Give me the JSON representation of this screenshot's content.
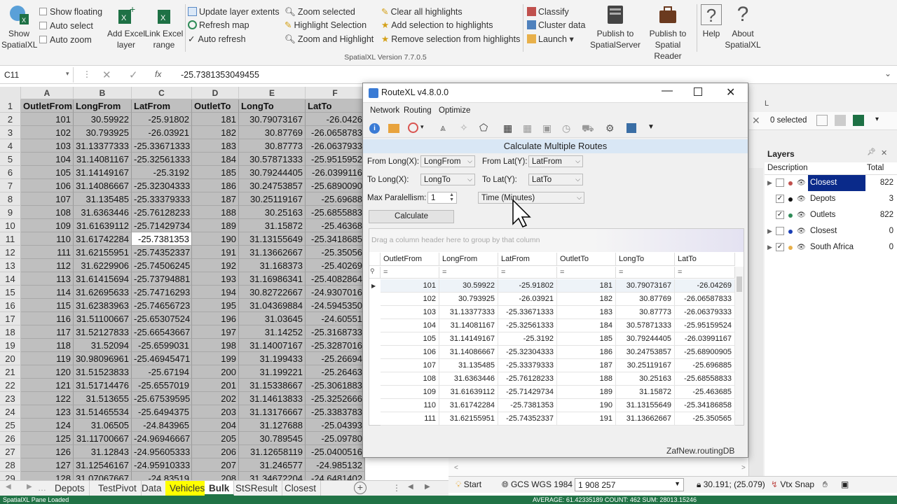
{
  "ribbon": {
    "show_spatialxl": "Show\nSpatialXL",
    "show_floating": "Show floating",
    "auto_select": "Auto select",
    "auto_zoom": "Auto zoom",
    "add_excel_layer": "Add Excel\nlayer",
    "link_excel_range": "Link Excel\nrange",
    "update_layer_extents": "Update layer extents",
    "refresh_map": "Refresh map",
    "auto_refresh": "Auto refresh",
    "zoom_selected": "Zoom selected",
    "highlight_selection": "Highlight Selection",
    "zoom_and_highlight": "Zoom and Highlight",
    "clear_all_highlights": "Clear all highlights",
    "add_selection_to_highlights": "Add selection to highlights",
    "remove_selection_from_highlights": "Remove selection from highlights",
    "classify": "Classify",
    "cluster_data": "Cluster data",
    "launch": "Launch",
    "publish_spatialserver": "Publish to\nSpatialServer",
    "publish_spatialreader": "Publish to\nSpatial Reader",
    "help": "Help",
    "about": "About\nSpatialXL",
    "version": "SpatialXL Version 7.7.0.5"
  },
  "formula": {
    "namebox": "C11",
    "value": "-25.7381353049455",
    "fx": "fx"
  },
  "sheet": {
    "columns": [
      "A",
      "B",
      "C",
      "D",
      "E",
      "F"
    ],
    "header": [
      "OutletFrom",
      "LongFrom",
      "LatFrom",
      "OutletTo",
      "LongTo",
      "LatTo"
    ],
    "rows": [
      [
        "101",
        "30.59922",
        "-25.91802",
        "181",
        "30.79073167",
        "-26.0426"
      ],
      [
        "102",
        "30.793925",
        "-26.03921",
        "182",
        "30.87769",
        "-26.0658783"
      ],
      [
        "103",
        "31.13377333",
        "-25.33671333",
        "183",
        "30.87773",
        "-26.0637933"
      ],
      [
        "104",
        "31.14081167",
        "-25.32561333",
        "184",
        "30.57871333",
        "-25.9515952"
      ],
      [
        "105",
        "31.14149167",
        "-25.3192",
        "185",
        "30.79244405",
        "-26.0399116"
      ],
      [
        "106",
        "31.14086667",
        "-25.32304333",
        "186",
        "30.24753857",
        "-25.6890090"
      ],
      [
        "107",
        "31.135485",
        "-25.33379333",
        "187",
        "30.25119167",
        "-25.69688"
      ],
      [
        "108",
        "31.6363446",
        "-25.76128233",
        "188",
        "30.25163",
        "-25.6855883"
      ],
      [
        "109",
        "31.61639112",
        "-25.71429734",
        "189",
        "31.15872",
        "-25.46368"
      ],
      [
        "110",
        "31.61742284",
        "-25.7381353",
        "190",
        "31.13155649",
        "-25.3418685"
      ],
      [
        "111",
        "31.62155951",
        "-25.74352337",
        "191",
        "31.13662667",
        "-25.35056"
      ],
      [
        "112",
        "31.6229906",
        "-25.74506245",
        "192",
        "31.168373",
        "-25.40269"
      ],
      [
        "113",
        "31.61415694",
        "-25.73794881",
        "193",
        "31.16986341",
        "-25.4082864"
      ],
      [
        "114",
        "31.62695633",
        "-25.74716293",
        "194",
        "30.82722667",
        "-24.9307016"
      ],
      [
        "115",
        "31.62383963",
        "-25.74656723",
        "195",
        "31.04369884",
        "-24.5945350"
      ],
      [
        "116",
        "31.51100667",
        "-25.65307524",
        "196",
        "31.03645",
        "-24.60551"
      ],
      [
        "117",
        "31.52127833",
        "-25.66543667",
        "197",
        "31.14252",
        "-25.3168733"
      ],
      [
        "118",
        "31.52094",
        "-25.6599031",
        "198",
        "31.14007167",
        "-25.3287016"
      ],
      [
        "119",
        "30.98096961",
        "-25.46945471",
        "199",
        "31.199433",
        "-25.26694"
      ],
      [
        "120",
        "31.51523833",
        "-25.67194",
        "200",
        "31.199221",
        "-25.26463"
      ],
      [
        "121",
        "31.51714476",
        "-25.6557019",
        "201",
        "31.15338667",
        "-25.3061883"
      ],
      [
        "122",
        "31.513655",
        "-25.67539595",
        "202",
        "31.14613833",
        "-25.3252666"
      ],
      [
        "123",
        "31.51465534",
        "-25.6494375",
        "203",
        "31.13176667",
        "-25.3383783"
      ],
      [
        "124",
        "31.06505",
        "-24.843965",
        "204",
        "31.127688",
        "-25.04393"
      ],
      [
        "125",
        "31.11700667",
        "-24.96946667",
        "205",
        "30.789545",
        "-25.09780"
      ],
      [
        "126",
        "31.12843",
        "-24.95605333",
        "206",
        "31.12658119",
        "-25.0400516"
      ],
      [
        "127",
        "31.12546167",
        "-24.95910333",
        "207",
        "31.246577",
        "-24.985132"
      ],
      [
        "128",
        "31.07067667",
        "-24.83519",
        "208",
        "31.34672204",
        "-24.6481402"
      ]
    ],
    "row_numbers": [
      "1",
      "2",
      "3",
      "4",
      "5",
      "6",
      "7",
      "8",
      "9",
      "10",
      "11",
      "12",
      "13",
      "14",
      "15",
      "16",
      "17",
      "18",
      "19",
      "20",
      "21",
      "22",
      "23",
      "24",
      "25",
      "26",
      "27",
      "28",
      "29"
    ]
  },
  "tabs": [
    "Depots",
    "TestPivot",
    "Data",
    "Vehicles",
    "Bulk",
    "StSResult",
    "Closest"
  ],
  "statusbar": {
    "left": "SpatialXL Pane Loaded",
    "right": "AVERAGE: 61.42335189   COUNT: 462   SUM: 28013.15246"
  },
  "layers": {
    "title": "Layers",
    "selected": "0 selected",
    "col_desc": "Description",
    "col_total": "Total",
    "items": [
      {
        "name": "Closest",
        "total": "822"
      },
      {
        "name": "Depots",
        "total": "3"
      },
      {
        "name": "Outlets",
        "total": "822"
      },
      {
        "name": "Closest",
        "total": "0"
      },
      {
        "name": "South Africa",
        "total": "0"
      }
    ]
  },
  "map_status": {
    "start": "Start",
    "crs": "GCS  WGS  1984",
    "scale": "1 908 257",
    "coords": "30.191; (25.079)",
    "snap": "Vtx Snap"
  },
  "dialog": {
    "title": "RouteXL v4.8.0.0",
    "menu": [
      "Network",
      "Routing",
      "Optimize"
    ],
    "heading": "Calculate Multiple Routes",
    "from_long_label": "From Long(X):",
    "from_long": "LongFrom",
    "from_lat_label": "From Lat(Y):",
    "from_lat": "LatFrom",
    "to_long_label": "To Long(X):",
    "to_long": "LongTo",
    "to_lat_label": "To Lat(Y):",
    "to_lat": "LatTo",
    "max_par_label": "Max Paralellism:",
    "max_par": "1",
    "cost": "Time (Minutes)",
    "calculate": "Calculate",
    "group_hint": "Drag a column header here to group by that column",
    "grid_cols": [
      "OutletFrom",
      "LongFrom",
      "LatFrom",
      "OutletTo",
      "LongTo",
      "LatTo"
    ],
    "grid_filter": "=",
    "grid_rows": [
      [
        "101",
        "30.59922",
        "-25.91802",
        "181",
        "30.79073167",
        "-26.04269"
      ],
      [
        "102",
        "30.793925",
        "-26.03921",
        "182",
        "30.87769",
        "-26.06587833"
      ],
      [
        "103",
        "31.13377333",
        "-25.33671333",
        "183",
        "30.87773",
        "-26.06379333"
      ],
      [
        "104",
        "31.14081167",
        "-25.32561333",
        "184",
        "30.57871333",
        "-25.95159524"
      ],
      [
        "105",
        "31.14149167",
        "-25.3192",
        "185",
        "30.79244405",
        "-26.03991167"
      ],
      [
        "106",
        "31.14086667",
        "-25.32304333",
        "186",
        "30.24753857",
        "-25.68900905"
      ],
      [
        "107",
        "31.135485",
        "-25.33379333",
        "187",
        "30.25119167",
        "-25.696885"
      ],
      [
        "108",
        "31.6363446",
        "-25.76128233",
        "188",
        "30.25163",
        "-25.68558833"
      ],
      [
        "109",
        "31.61639112",
        "-25.71429734",
        "189",
        "31.15872",
        "-25.463685"
      ],
      [
        "110",
        "31.61742284",
        "-25.7381353",
        "190",
        "31.13155649",
        "-25.34186858"
      ],
      [
        "111",
        "31.62155951",
        "-25.74352337",
        "191",
        "31.13662667",
        "-25.350565"
      ]
    ],
    "footer": "ZafNew.routingDB"
  }
}
